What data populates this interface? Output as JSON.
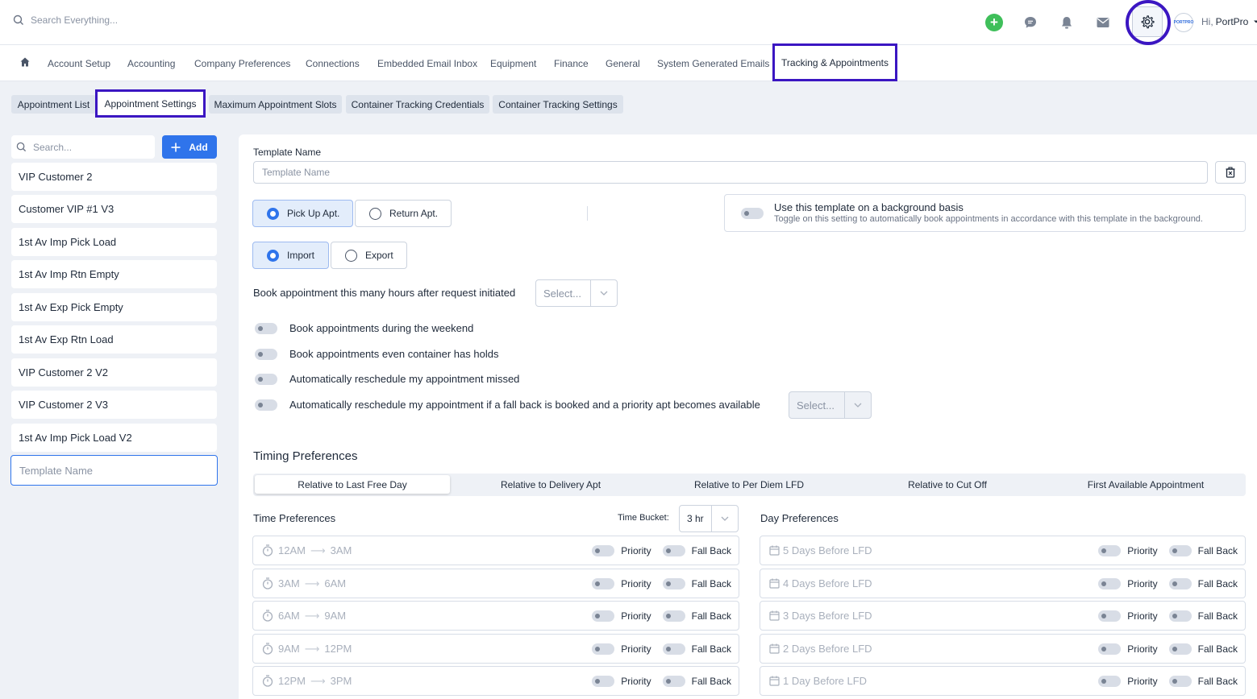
{
  "topbar": {
    "search_placeholder": "Search Everything...",
    "greeting_hi": "Hi,",
    "greeting_name": "PortPro",
    "avatar_text": "PORTPRO"
  },
  "nav": {
    "items": [
      "Account Setup",
      "Accounting",
      "Company Preferences",
      "Connections",
      "Embedded Email Inbox",
      "Equipment",
      "Finance",
      "General",
      "System Generated Emails"
    ],
    "active": "Tracking & Appointments"
  },
  "subtabs": {
    "items": [
      "Appointment List",
      "Appointment Settings",
      "Maximum Appointment Slots",
      "Container Tracking Credentials",
      "Container Tracking Settings"
    ]
  },
  "left": {
    "search_placeholder": "Search...",
    "add_label": "Add",
    "templates": [
      "VIP Customer 2",
      "Customer VIP #1 V3",
      "1st Av Imp Pick Load",
      "1st Av Imp Rtn Empty",
      "1st Av Exp Pick Empty",
      "1st Av Exp Rtn Load",
      "VIP Customer 2 V2",
      "VIP Customer 2 V3",
      "1st Av Imp Pick Load V2"
    ],
    "new_template_placeholder": "Template Name"
  },
  "form": {
    "template_name_label": "Template Name",
    "template_name_placeholder": "Template Name",
    "apt_type": {
      "pickup": "Pick Up Apt.",
      "return": "Return Apt.",
      "selected": "pickup"
    },
    "move_type": {
      "import": "Import",
      "export": "Export",
      "selected": "import"
    },
    "background": {
      "title": "Use this template on a background basis",
      "desc": "Toggle on this setting to automatically book appointments in accordance with this template in the background."
    },
    "book_hours_label": "Book appointment this many hours after request initiated",
    "book_hours_select": "Select...",
    "toggles": [
      "Book appointments during the weekend",
      "Book appointments even container has holds",
      "Automatically reschedule my appointment missed",
      "Automatically reschedule my appointment if a fall back is booked and a priority apt becomes available"
    ],
    "reschedule_select": "Select..."
  },
  "timing": {
    "title": "Timing Preferences",
    "tabs": [
      "Relative to Last Free Day",
      "Relative to Delivery Apt",
      "Relative to Per Diem LFD",
      "Relative to Cut Off",
      "First Available Appointment"
    ],
    "active_tab": 0
  },
  "time_prefs": {
    "title": "Time Preferences",
    "bucket_label": "Time Bucket:",
    "bucket_value": "3 hr",
    "priority_label": "Priority",
    "fallback_label": "Fall Back",
    "rows": [
      {
        "from": "12AM",
        "to": "3AM"
      },
      {
        "from": "3AM",
        "to": "6AM"
      },
      {
        "from": "6AM",
        "to": "9AM"
      },
      {
        "from": "9AM",
        "to": "12PM"
      },
      {
        "from": "12PM",
        "to": "3PM"
      }
    ]
  },
  "day_prefs": {
    "title": "Day Preferences",
    "priority_label": "Priority",
    "fallback_label": "Fall Back",
    "rows": [
      "5 Days Before LFD",
      "4 Days Before LFD",
      "3 Days Before LFD",
      "2 Days Before LFD",
      "1 Day Before LFD"
    ]
  },
  "colors": {
    "accent": "#2f74eb",
    "highlight": "#3b16c2",
    "add_icon": "#3fbf5a"
  }
}
